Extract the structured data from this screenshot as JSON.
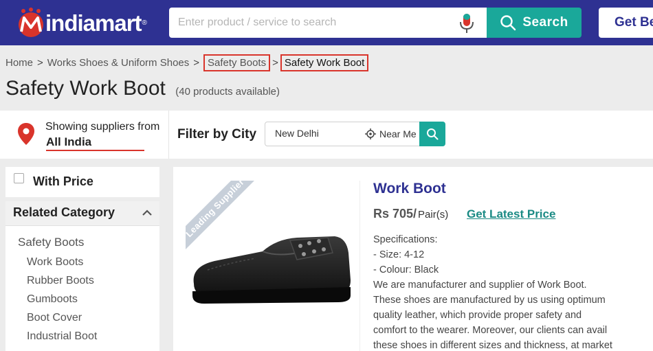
{
  "header": {
    "brand": "indiamart",
    "brand_reg": "®",
    "search_placeholder": "Enter product / service to search",
    "search_label": "Search",
    "get_best_label": "Get Be",
    "colors": {
      "header_bg": "#2e3192",
      "accent": "#1aa89a",
      "logo_red": "#d9342b"
    }
  },
  "breadcrumb": {
    "items": [
      "Home",
      "Works Shoes & Uniform Shoes",
      "Safety Boots",
      "Safety Work Boot"
    ],
    "separator": ">"
  },
  "page": {
    "title": "Safety Work Boot",
    "count_text": "(40 products available)"
  },
  "location": {
    "showing_text": "Showing suppliers from",
    "region": "All India",
    "filter_label": "Filter by City",
    "city_value": "New Delhi",
    "near_me_label": "Near Me"
  },
  "sidebar": {
    "with_price_label": "With Price",
    "related_title": "Related Category",
    "main_category": "Safety Boots",
    "categories": [
      "Work Boots",
      "Rubber Boots",
      "Gumboots",
      "Boot Cover",
      "Industrial Boot"
    ]
  },
  "product": {
    "ribbon": "Leading Supplier",
    "title": "Work Boot",
    "price": "Rs 705/",
    "unit": "Pair(s)",
    "latest_price_label": "Get Latest Price",
    "spec_lines": [
      "Specifications:",
      "- Size: 4-12",
      "- Colour: Black",
      "We are manufacturer and supplier of Work Boot.",
      "These shoes are manufactured by us using optimum",
      "quality leather, which provide proper safety and",
      "comfort to the wearer. Moreover, our clients can avail",
      "these shoes in different sizes and thickness, at market"
    ]
  }
}
